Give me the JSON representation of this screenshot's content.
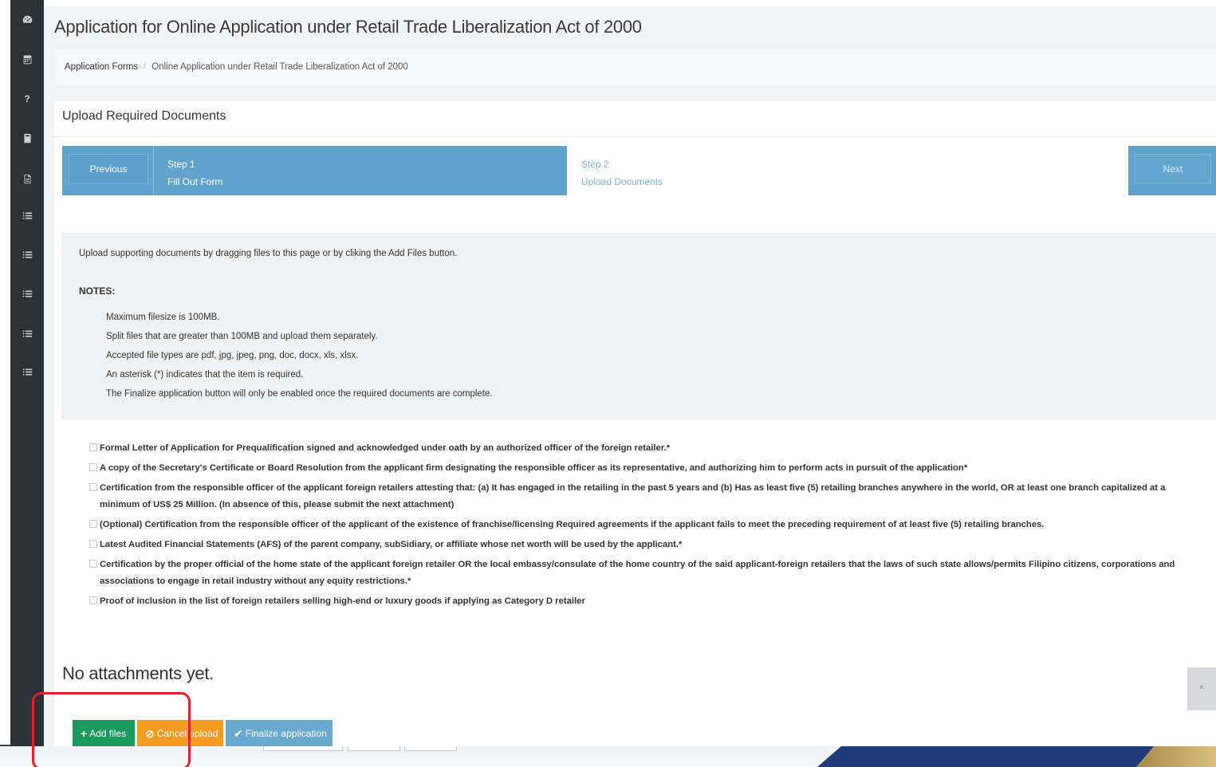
{
  "page": {
    "title": "Application for Online Application under Retail Trade Liberalization Act of 2000"
  },
  "breadcrumb": {
    "root": "Application Forms",
    "separator": "/",
    "current": "Online Application under Retail Trade Liberalization Act of 2000"
  },
  "panel": {
    "title": "Upload Required Documents"
  },
  "wizard": {
    "previous_label": "Previous",
    "next_label": "Next",
    "steps": [
      {
        "number": "Step 1",
        "label": "Fill Out Form",
        "state": "done"
      },
      {
        "number": "Step 2",
        "label": "Upload Documents",
        "state": "current"
      }
    ]
  },
  "info": {
    "intro": "Upload supporting documents by dragging files to this page or by cliking the Add Files button.",
    "notes_heading": "NOTES:",
    "notes": [
      "Maximum filesize is 100MB.",
      "Split files that are greater than 100MB and upload them separately.",
      "Accepted file types are pdf, jpg, jpeg, png, doc, docx, xls, xlsx.",
      "An asterisk (*) indicates that the item is required.",
      "The Finalize application button will only be enabled once the required documents are complete."
    ]
  },
  "requirements": [
    "Formal Letter of Application for Prequalification signed and acknowledged under oath by an authorized officer of the foreign retailer.*",
    "A copy of the Secretary's Certificate or Board Resolution from the applicant firm designating the responsible officer as its representative, and authorizing him to perform acts in pursuit of the application*",
    "Certification from the responsible officer of the applicant foreign retailers attesting that: (a) It has engaged in the retailing in the past 5 years and (b) Has as least five (5) retailing branches anywhere in the world, OR at least one branch capitalized at a minimum of US$ 25 Million. (In absence of this, please submit the next attachment)",
    "(Optional) Certification from the responsible officer of the applicant of the existence of franchise/licensing Required agreements if the applicant fails to meet the preceding requirement of at least five (5) retailing branches.",
    "Latest Audited Financial Statements (AFS) of the parent company, subSidiary, or affiliate whose net worth will be used by the applicant.*",
    "Certification by the proper official of the home state of the applicant foreign retailer OR the local embassy/consulate of the home country of the said applicant-foreign retailers that the laws of such state allows/permits Filipino citizens, corporations and associations to engage in retail industry without any equity restrictions.*",
    "Proof of inclusion in the list of foreign retailers selling high-end or luxury goods if applying as Category D retailer"
  ],
  "attachments": {
    "empty_text": "No attachments yet."
  },
  "actions": {
    "add_label": "Add files",
    "cancel_label": "Cancel upload",
    "finalize_label": "Finalize application"
  },
  "scroll_top_glyph": "^",
  "sidebar": {
    "icons": [
      "dashboard-icon",
      "calendar-icon",
      "question-icon",
      "book-icon",
      "document-icon",
      "list-icon",
      "list-icon",
      "list-icon",
      "list-icon",
      "list-icon"
    ]
  },
  "colors": {
    "sidebar": "#2a3238",
    "wizard": "#60a3cc",
    "add_button": "#1a9a5c",
    "cancel_button": "#f39c21",
    "finalize_button": "#68a9d0",
    "highlight": "#e4202b"
  }
}
